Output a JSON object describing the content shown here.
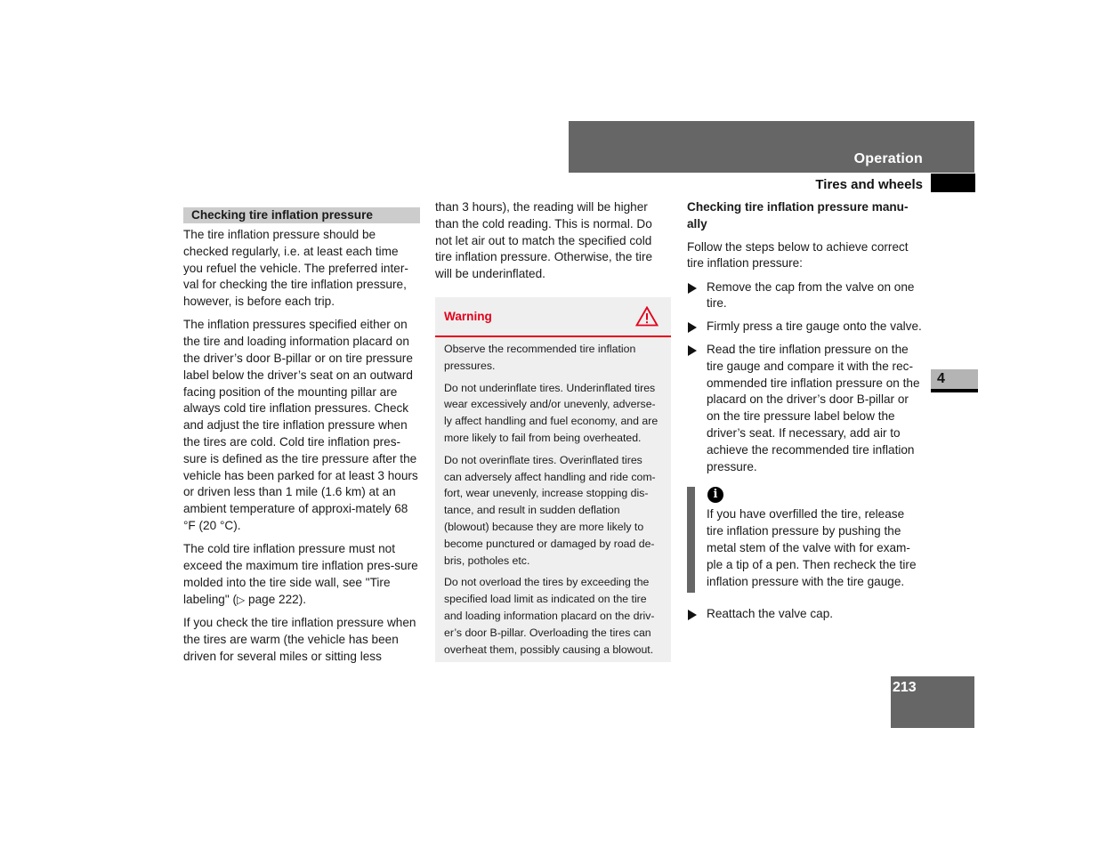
{
  "header": {
    "section": "Operation",
    "subsection": "Tires and wheels"
  },
  "chapter_tab": "4",
  "page_number": "213",
  "left_column": {
    "section_heading": "Checking tire inflation pressure",
    "paragraphs": [
      "The tire inflation pressure should be checked regularly, i.e. at least each time you refuel the vehicle. The preferred inter-val for checking the tire inflation pressure, however, is before each trip.",
      "The inflation pressures specified either on the tire and loading information placard on the driver’s door B-pillar or on tire pressure label below the driver’s seat on an outward facing position of the mounting pillar are always cold tire inflation pressures. Check and adjust the tire inflation pressure when the tires are cold. Cold tire inflation pres-sure is defined as the tire pressure after the vehicle has been parked for at least 3 hours or driven less than 1 mile (1.6 km) at an ambient temperature of approxi-mately 68 °F (20 °C).",
      "If you check the tire inflation pressure when the tires are warm (the vehicle has been driven for several miles or sitting less"
    ],
    "xref_paragraph": {
      "before": "The cold tire inflation pressure must not exceed the maximum tire inflation pres-sure molded into the tire side wall, see \"Tire labeling\" (",
      "arrow": "▷",
      "after": " page 222)."
    }
  },
  "middle_column": {
    "continuation": "than 3 hours), the reading will be higher than the cold reading. This is normal. Do not let air out to match the specified cold tire inflation pressure. Otherwise, the tire will be underinflated.",
    "warning": {
      "label": "Warning",
      "icon": "warning-triangle-icon",
      "color": "#e3001b",
      "paragraphs": [
        "Observe the recommended tire inflation pressures.",
        "Do not underinflate tires. Underinflated tires wear excessively and/or unevenly, adverse-ly affect handling and fuel economy, and are more likely to fail from being overheated.",
        "Do not overinflate tires. Overinflated tires can adversely affect handling and ride com-fort, wear unevenly, increase stopping dis-tance, and result in sudden deflation (blowout) because they are more likely to become punctured or damaged by road de-bris, potholes etc.",
        "Do not overload the tires by exceeding the specified load limit as indicated on the tire and loading information placard on the driv-er’s door B-pillar. Overloading the tires can overheat them, possibly causing a blowout."
      ]
    }
  },
  "right_column": {
    "heading": "Checking tire inflation pressure manu-ally",
    "intro": "Follow the steps below to achieve correct tire inflation pressure:",
    "steps": [
      "Remove the cap from the valve on one tire.",
      "Firmly press a tire gauge onto the valve.",
      "Read the tire inflation pressure on the tire gauge and compare it with the rec-ommended tire inflation pressure on the placard on the driver’s door B-pillar or on the tire pressure label below the driver’s seat. If necessary, add air to achieve the recommended tire inflation pressure."
    ],
    "note": {
      "icon": "info-icon",
      "icon_glyph": "i",
      "text": "If you have overfilled the tire, release tire inflation pressure by pushing the metal stem of the valve with for exam-ple a tip of a pen. Then recheck the tire inflation pressure with the tire gauge."
    },
    "final_step": "Reattach the valve cap."
  }
}
